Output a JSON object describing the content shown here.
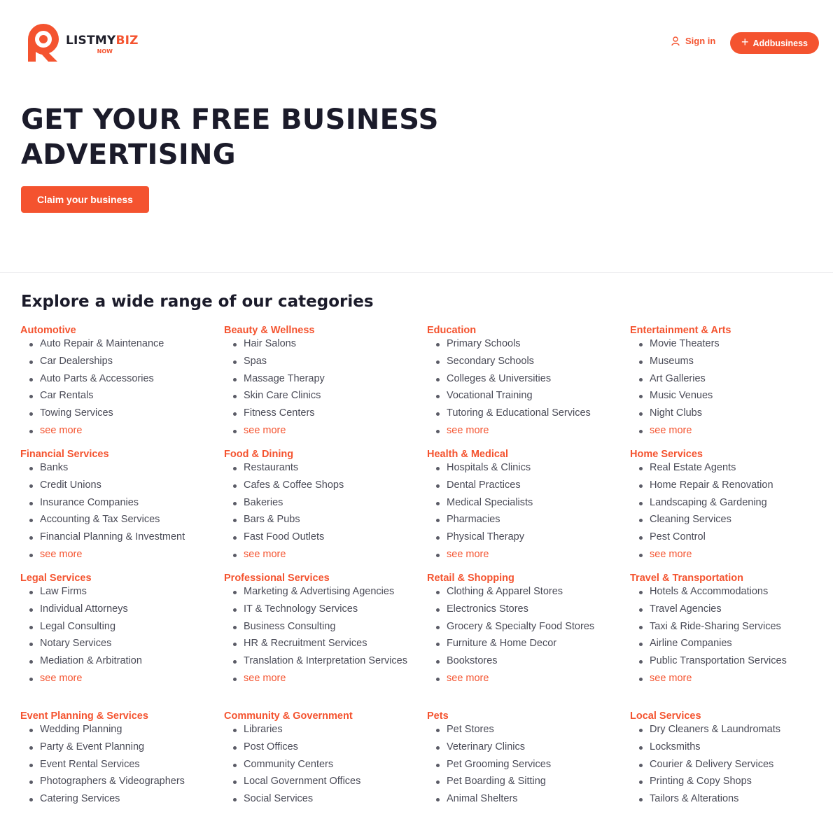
{
  "header": {
    "logo_name_main": "LISTMY",
    "logo_name_accent": "BIZ",
    "logo_sub": "NOW",
    "signin_label": "Sign in",
    "add_plus": "+",
    "add_label": "Addbusiness"
  },
  "hero": {
    "title": "GET YOUR FREE BUSINESS ADVERTISING",
    "claim_label": "Claim your business"
  },
  "categories_title": "Explore a wide range of our categories",
  "see_more_label": "see more",
  "colors": {
    "accent": "#f4532f",
    "heading": "#1b1b2a",
    "text": "#4a4b57"
  },
  "categories": [
    {
      "name": "Automotive",
      "items": [
        "Auto Repair & Maintenance",
        "Car Dealerships",
        "Auto Parts & Accessories",
        "Car Rentals",
        "Towing Services",
        "see more"
      ]
    },
    {
      "name": "Beauty & Wellness",
      "items": [
        "Hair Salons",
        "Spas",
        "Massage Therapy",
        "Skin Care Clinics",
        "Fitness Centers",
        "see more"
      ]
    },
    {
      "name": "Education",
      "items": [
        "Primary Schools",
        "Secondary Schools",
        "Colleges & Universities",
        "Vocational Training",
        "Tutoring & Educational Services",
        "see more"
      ]
    },
    {
      "name": "Entertainment & Arts",
      "items": [
        "Movie Theaters",
        "Museums",
        "Art Galleries",
        "Music Venues",
        "Night Clubs",
        "see more"
      ]
    },
    {
      "name": "Financial Services",
      "items": [
        "Banks",
        "Credit Unions",
        "Insurance Companies",
        "Accounting & Tax Services",
        "Financial Planning & Investment",
        "see more"
      ]
    },
    {
      "name": "Food & Dining",
      "items": [
        "Restaurants",
        "Cafes & Coffee Shops",
        "Bakeries",
        "Bars & Pubs",
        "Fast Food Outlets",
        "see more"
      ]
    },
    {
      "name": "Health & Medical",
      "items": [
        "Hospitals & Clinics",
        "Dental Practices",
        "Medical Specialists",
        "Pharmacies",
        "Physical Therapy",
        "see more"
      ]
    },
    {
      "name": "Home Services",
      "items": [
        "Real Estate Agents",
        "Home Repair & Renovation",
        "Landscaping & Gardening",
        "Cleaning Services",
        "Pest Control",
        "see more"
      ]
    },
    {
      "name": "Legal Services",
      "items": [
        "Law Firms",
        "Individual Attorneys",
        "Legal Consulting",
        "Notary Services",
        "Mediation & Arbitration",
        "see more"
      ]
    },
    {
      "name": "Professional Services",
      "items": [
        "Marketing & Advertising Agencies",
        "IT & Technology Services",
        "Business Consulting",
        "HR & Recruitment Services",
        "Translation & Interpretation Services",
        "see more"
      ]
    },
    {
      "name": "Retail & Shopping",
      "items": [
        "Clothing & Apparel Stores",
        "Electronics Stores",
        "Grocery & Specialty Food Stores",
        "Furniture & Home Decor",
        "Bookstores",
        "see more"
      ]
    },
    {
      "name": "Travel & Transportation",
      "items": [
        "Hotels & Accommodations",
        "Travel Agencies",
        "Taxi & Ride-Sharing Services",
        "Airline Companies",
        "Public Transportation Services",
        "see more"
      ]
    },
    {
      "name": "Event Planning & Services",
      "items": [
        "Wedding Planning",
        "Party & Event Planning",
        "Event Rental Services",
        "Photographers & Videographers",
        "Catering Services"
      ]
    },
    {
      "name": "Community & Government",
      "items": [
        "Libraries",
        "Post Offices",
        "Community Centers",
        "Local Government Offices",
        "Social Services"
      ]
    },
    {
      "name": "Pets",
      "items": [
        "Pet Stores",
        "Veterinary Clinics",
        "Pet Grooming Services",
        "Pet Boarding & Sitting",
        "Animal Shelters"
      ]
    },
    {
      "name": "Local Services",
      "items": [
        "Dry Cleaners & Laundromats",
        "Locksmiths",
        "Courier & Delivery Services",
        "Printing & Copy Shops",
        "Tailors & Alterations"
      ]
    }
  ]
}
